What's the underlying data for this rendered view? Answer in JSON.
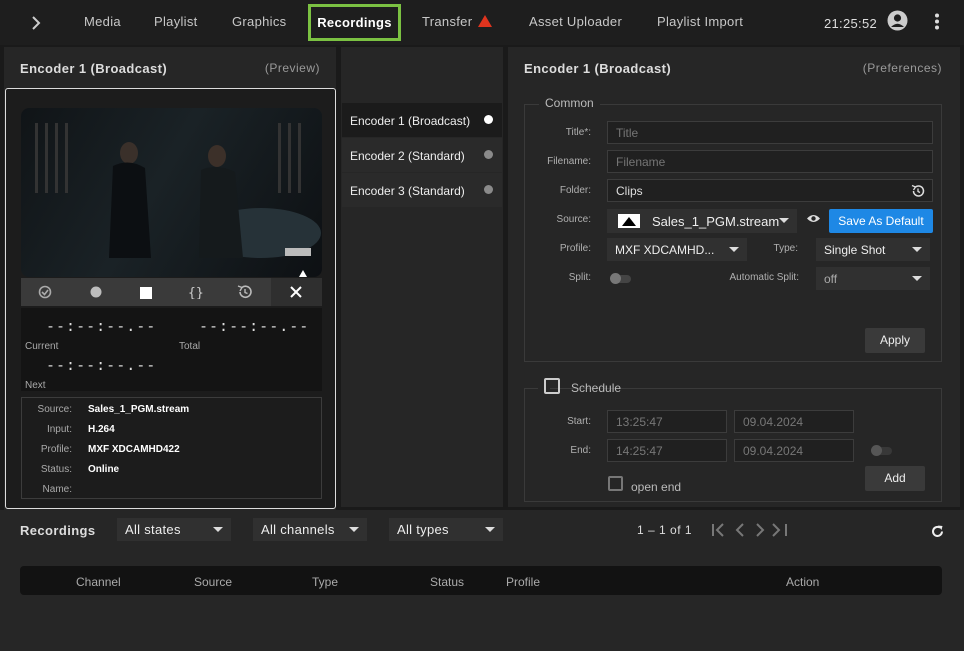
{
  "nav": {
    "items": [
      "Media",
      "Playlist",
      "Graphics",
      "Recordings",
      "Transfer",
      "Asset Uploader",
      "Playlist Import"
    ],
    "active": "Recordings",
    "clock": "21:25:52"
  },
  "preview": {
    "title": "Encoder 1 (Broadcast)",
    "link": "(Preview)",
    "current_tc": "--:--:--.--",
    "current_label": "Current",
    "total_tc": "--:--:--.--",
    "total_label": "Total",
    "next_tc": "--:--:--.--",
    "next_label": "Next",
    "info": {
      "source_label": "Source:",
      "source": "Sales_1_PGM.stream",
      "input_label": "Input:",
      "input": "H.264",
      "profile_label": "Profile:",
      "profile": "MXF XDCAMHD422",
      "status_label": "Status:",
      "status": "Online",
      "name_label": "Name:",
      "name": ""
    }
  },
  "encoders": [
    {
      "label": "Encoder 1 (Broadcast)",
      "active": true
    },
    {
      "label": "Encoder 2 (Standard)",
      "active": false
    },
    {
      "label": "Encoder 3 (Standard)",
      "active": false
    }
  ],
  "prefs": {
    "title": "Encoder 1 (Broadcast)",
    "link": "(Preferences)",
    "common_label": "Common",
    "title_label": "Title*:",
    "title_placeholder": "Title",
    "filename_label": "Filename:",
    "filename_placeholder": "Filename",
    "folder_label": "Folder:",
    "folder_value": "Clips",
    "source_label": "Source:",
    "source_value": "Sales_1_PGM.stream",
    "save_default": "Save As Default",
    "profile_label": "Profile:",
    "profile_value": "MXF XDCAMHD...",
    "type_label": "Type:",
    "type_value": "Single Shot",
    "split_label": "Split:",
    "auto_split_label": "Automatic Split:",
    "auto_split_value": "off",
    "apply": "Apply",
    "schedule_label": "Schedule",
    "start_label": "Start:",
    "start_time": "13:25:47",
    "start_date": "09.04.2024",
    "end_label": "End:",
    "end_time": "14:25:47",
    "end_date": "09.04.2024",
    "open_end": "open end",
    "add": "Add"
  },
  "recordings": {
    "title": "Recordings",
    "filter_states": "All states",
    "filter_channels": "All channels",
    "filter_types": "All types",
    "pagination": "1 – 1 of 1",
    "columns": [
      "Channel",
      "Source",
      "Type",
      "Status",
      "Profile",
      "Action"
    ]
  },
  "colors": {
    "accent_green": "#7bc142",
    "primary_blue": "#1e88e5",
    "warning_red": "#e0341e"
  }
}
